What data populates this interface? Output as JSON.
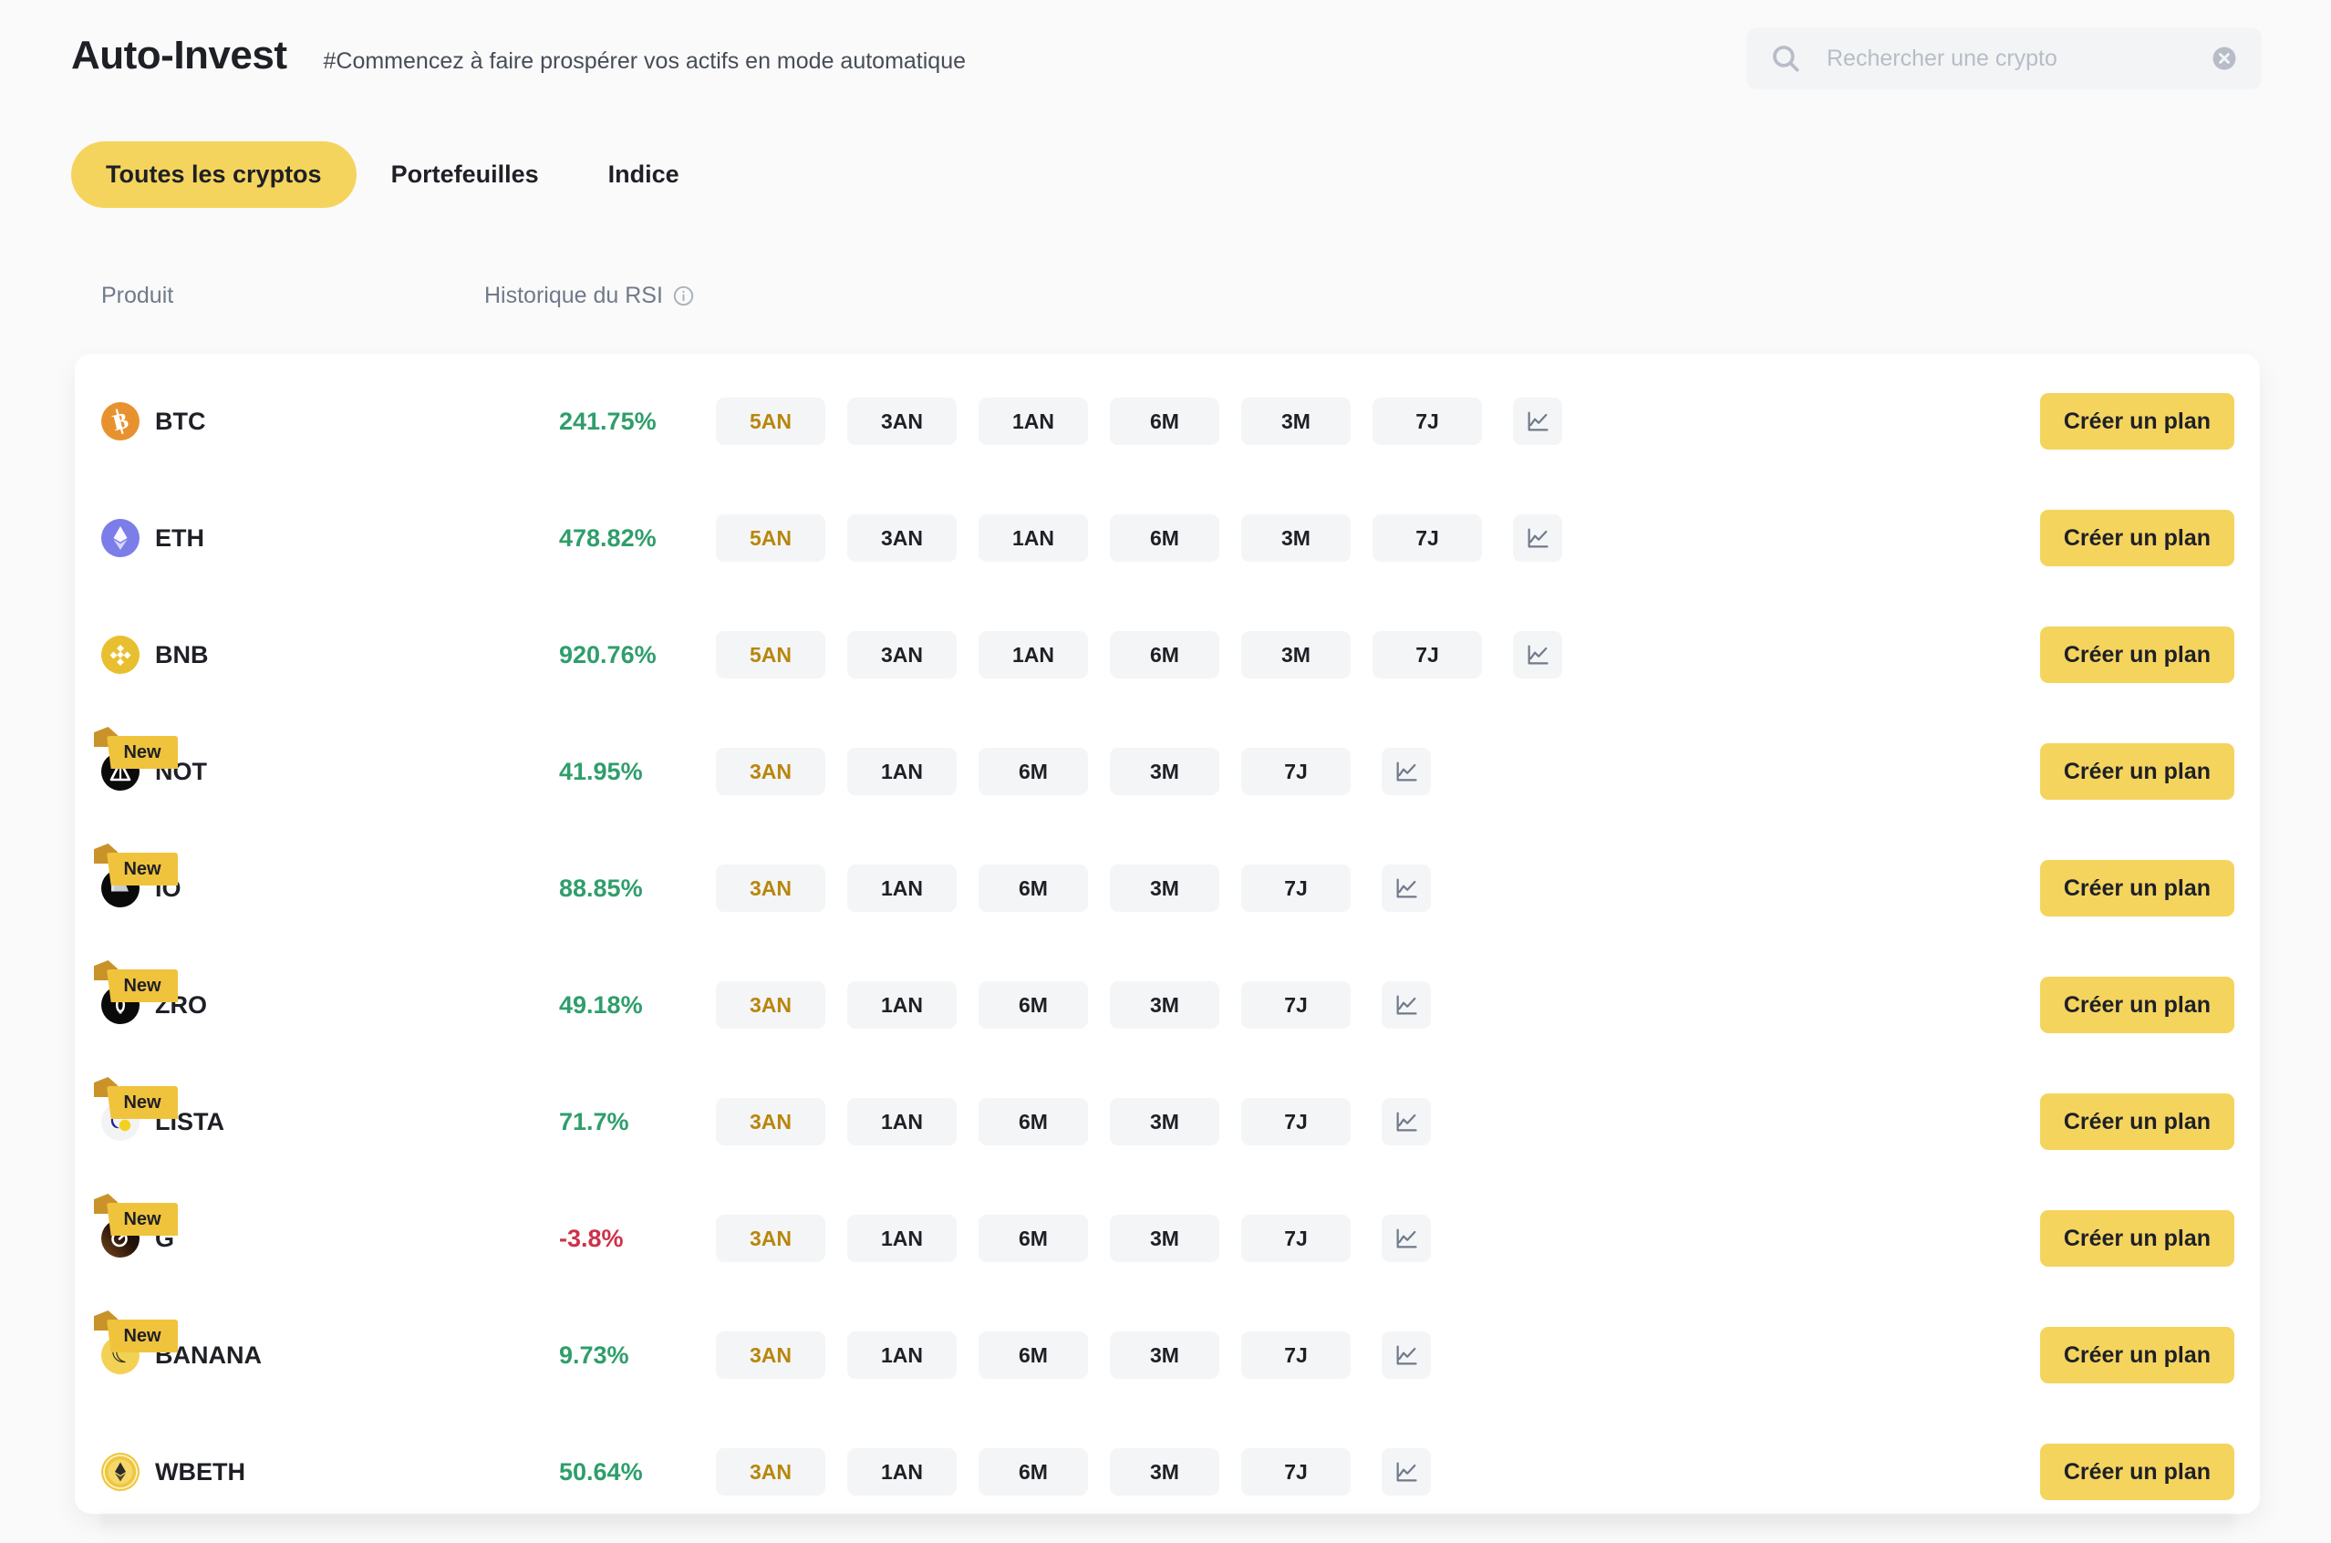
{
  "header": {
    "title": "Auto-Invest",
    "subtitle": "#Commencez à faire prospérer vos actifs en mode automatique"
  },
  "search": {
    "placeholder": "Rechercher une crypto",
    "value": "",
    "icon": "search-icon",
    "clear_icon": "clear-circle-icon"
  },
  "tabs": [
    {
      "label": "Toutes les cryptos",
      "active": true
    },
    {
      "label": "Portefeuilles",
      "active": false
    },
    {
      "label": "Indice",
      "active": false
    }
  ],
  "columns": {
    "product": "Produit",
    "rsi": "Historique du RSI",
    "rsi_info_icon": "info-circle-icon"
  },
  "colors": {
    "accent": "#F5D45E",
    "up": "#2F9E6B",
    "down": "#CF304A",
    "chip_selected_text": "#B8860B",
    "chip_bg": "#F4F5F7",
    "page_bg": "#FAFAFA",
    "card_bg": "#FFFFFF"
  },
  "badges": {
    "new": "New"
  },
  "actions": {
    "create_plan": "Créer un plan",
    "chart_icon": "line-chart-icon"
  },
  "rows": [
    {
      "symbol": "BTC",
      "icon": "btc-icon",
      "rsi": "241.75%",
      "dir": "up",
      "new": false,
      "periods": [
        {
          "label": "5AN",
          "selected": true
        },
        {
          "label": "3AN",
          "selected": false
        },
        {
          "label": "1AN",
          "selected": false
        },
        {
          "label": "6M",
          "selected": false
        },
        {
          "label": "3M",
          "selected": false
        },
        {
          "label": "7J",
          "selected": false
        }
      ]
    },
    {
      "symbol": "ETH",
      "icon": "eth-icon",
      "rsi": "478.82%",
      "dir": "up",
      "new": false,
      "periods": [
        {
          "label": "5AN",
          "selected": true
        },
        {
          "label": "3AN",
          "selected": false
        },
        {
          "label": "1AN",
          "selected": false
        },
        {
          "label": "6M",
          "selected": false
        },
        {
          "label": "3M",
          "selected": false
        },
        {
          "label": "7J",
          "selected": false
        }
      ]
    },
    {
      "symbol": "BNB",
      "icon": "bnb-icon",
      "rsi": "920.76%",
      "dir": "up",
      "new": false,
      "periods": [
        {
          "label": "5AN",
          "selected": true
        },
        {
          "label": "3AN",
          "selected": false
        },
        {
          "label": "1AN",
          "selected": false
        },
        {
          "label": "6M",
          "selected": false
        },
        {
          "label": "3M",
          "selected": false
        },
        {
          "label": "7J",
          "selected": false
        }
      ]
    },
    {
      "symbol": "NOT",
      "icon": "not-icon",
      "rsi": "41.95%",
      "dir": "up",
      "new": true,
      "periods": [
        {
          "label": "3AN",
          "selected": true
        },
        {
          "label": "1AN",
          "selected": false
        },
        {
          "label": "6M",
          "selected": false
        },
        {
          "label": "3M",
          "selected": false
        },
        {
          "label": "7J",
          "selected": false
        }
      ]
    },
    {
      "symbol": "IO",
      "icon": "io-icon",
      "rsi": "88.85%",
      "dir": "up",
      "new": true,
      "periods": [
        {
          "label": "3AN",
          "selected": true
        },
        {
          "label": "1AN",
          "selected": false
        },
        {
          "label": "6M",
          "selected": false
        },
        {
          "label": "3M",
          "selected": false
        },
        {
          "label": "7J",
          "selected": false
        }
      ]
    },
    {
      "symbol": "ZRO",
      "icon": "zro-icon",
      "rsi": "49.18%",
      "dir": "up",
      "new": true,
      "periods": [
        {
          "label": "3AN",
          "selected": true
        },
        {
          "label": "1AN",
          "selected": false
        },
        {
          "label": "6M",
          "selected": false
        },
        {
          "label": "3M",
          "selected": false
        },
        {
          "label": "7J",
          "selected": false
        }
      ]
    },
    {
      "symbol": "LISTA",
      "icon": "lista-icon",
      "rsi": "71.7%",
      "dir": "up",
      "new": true,
      "periods": [
        {
          "label": "3AN",
          "selected": true
        },
        {
          "label": "1AN",
          "selected": false
        },
        {
          "label": "6M",
          "selected": false
        },
        {
          "label": "3M",
          "selected": false
        },
        {
          "label": "7J",
          "selected": false
        }
      ]
    },
    {
      "symbol": "G",
      "icon": "g-icon",
      "rsi": "-3.8%",
      "dir": "down",
      "new": true,
      "periods": [
        {
          "label": "3AN",
          "selected": true
        },
        {
          "label": "1AN",
          "selected": false
        },
        {
          "label": "6M",
          "selected": false
        },
        {
          "label": "3M",
          "selected": false
        },
        {
          "label": "7J",
          "selected": false
        }
      ]
    },
    {
      "symbol": "BANANA",
      "icon": "banana-icon",
      "rsi": "9.73%",
      "dir": "up",
      "new": true,
      "periods": [
        {
          "label": "3AN",
          "selected": true
        },
        {
          "label": "1AN",
          "selected": false
        },
        {
          "label": "6M",
          "selected": false
        },
        {
          "label": "3M",
          "selected": false
        },
        {
          "label": "7J",
          "selected": false
        }
      ]
    },
    {
      "symbol": "WBETH",
      "icon": "wbeth-icon",
      "rsi": "50.64%",
      "dir": "up",
      "new": false,
      "periods": [
        {
          "label": "3AN",
          "selected": true
        },
        {
          "label": "1AN",
          "selected": false
        },
        {
          "label": "6M",
          "selected": false
        },
        {
          "label": "3M",
          "selected": false
        },
        {
          "label": "7J",
          "selected": false
        }
      ]
    }
  ]
}
